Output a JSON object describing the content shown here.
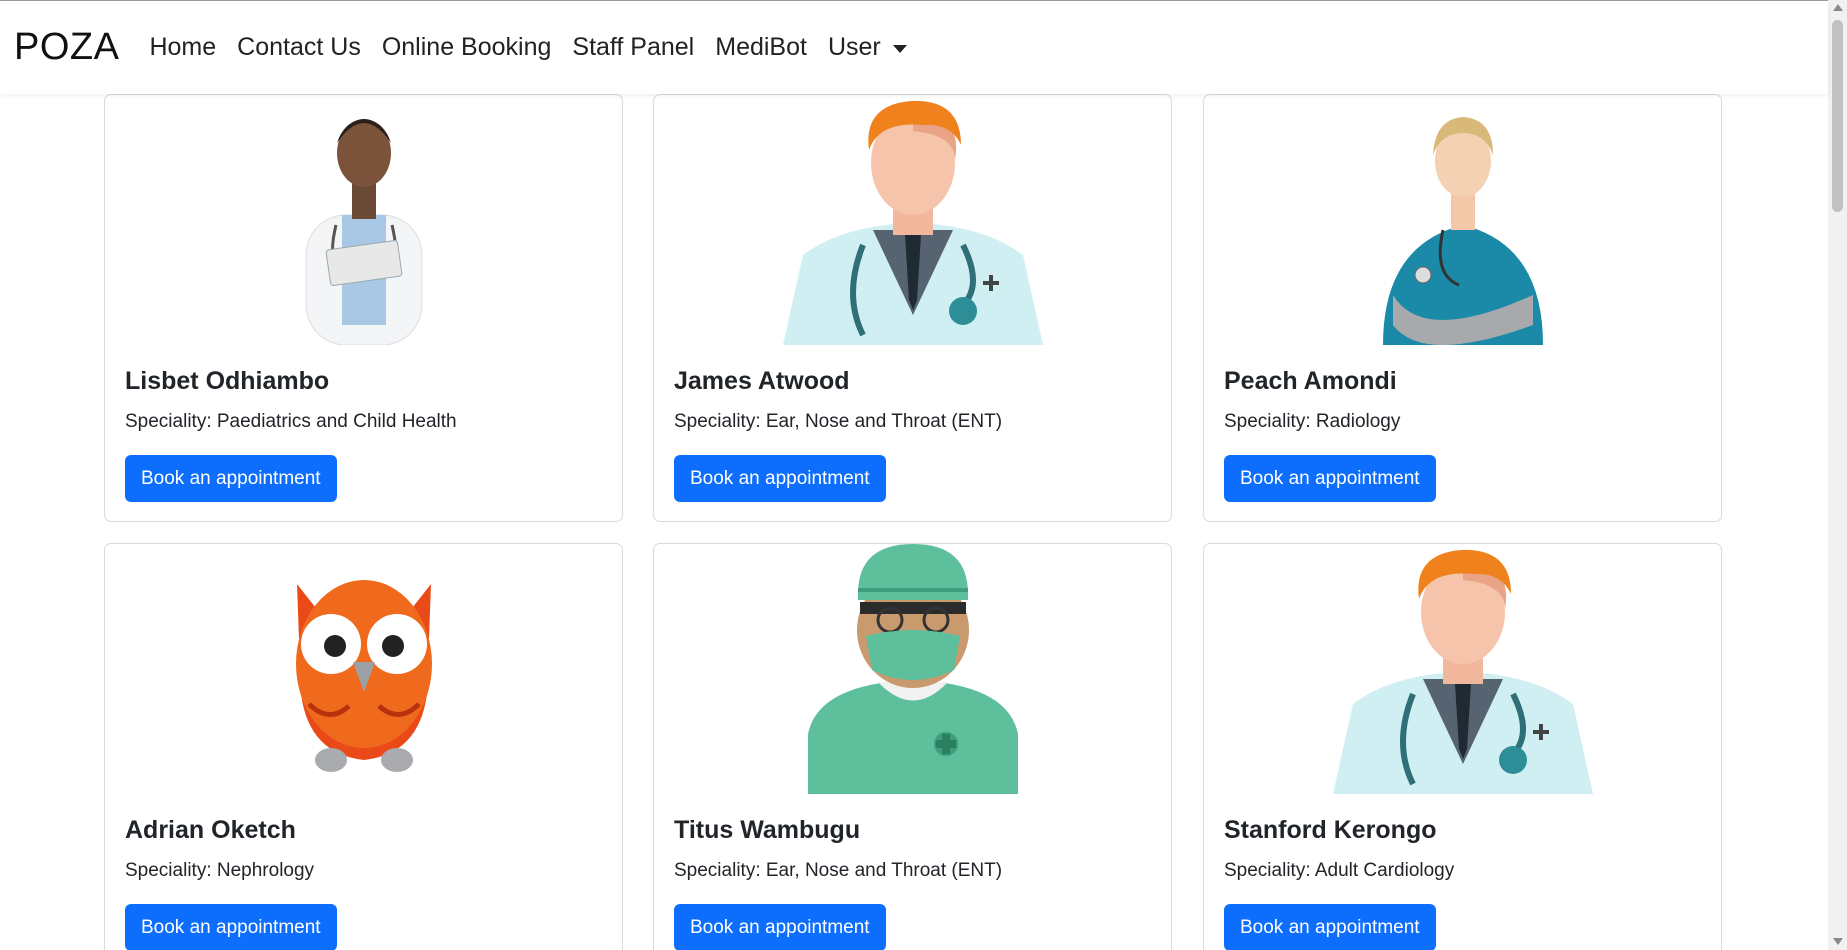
{
  "nav": {
    "brand": "POZA",
    "links": [
      "Home",
      "Contact Us",
      "Online Booking",
      "Staff Panel",
      "MediBot"
    ],
    "user_label": "User"
  },
  "doctors": [
    {
      "name": "Lisbet Odhiambo",
      "speciality": "Speciality: Paediatrics and Child Health",
      "button": "Book an appointment",
      "image": "female-doctor-photo"
    },
    {
      "name": "James Atwood",
      "speciality": "Speciality: Ear, Nose and Throat (ENT)",
      "button": "Book an appointment",
      "image": "male-doctor-avatar"
    },
    {
      "name": "Peach Amondi",
      "speciality": "Speciality: Radiology",
      "button": "Book an appointment",
      "image": "nurse-photo"
    },
    {
      "name": "Adrian Oketch",
      "speciality": "Speciality: Nephrology",
      "button": "Book an appointment",
      "image": "owl-avatar"
    },
    {
      "name": "Titus Wambugu",
      "speciality": "Speciality: Ear, Nose and Throat (ENT)",
      "button": "Book an appointment",
      "image": "surgeon-avatar"
    },
    {
      "name": "Stanford Kerongo",
      "speciality": "Speciality: Adult Cardiology",
      "button": "Book an appointment",
      "image": "male-doctor-avatar"
    }
  ],
  "colors": {
    "primary_button": "#0d6efd",
    "card_border": "#d8dadd",
    "text": "#212529"
  }
}
